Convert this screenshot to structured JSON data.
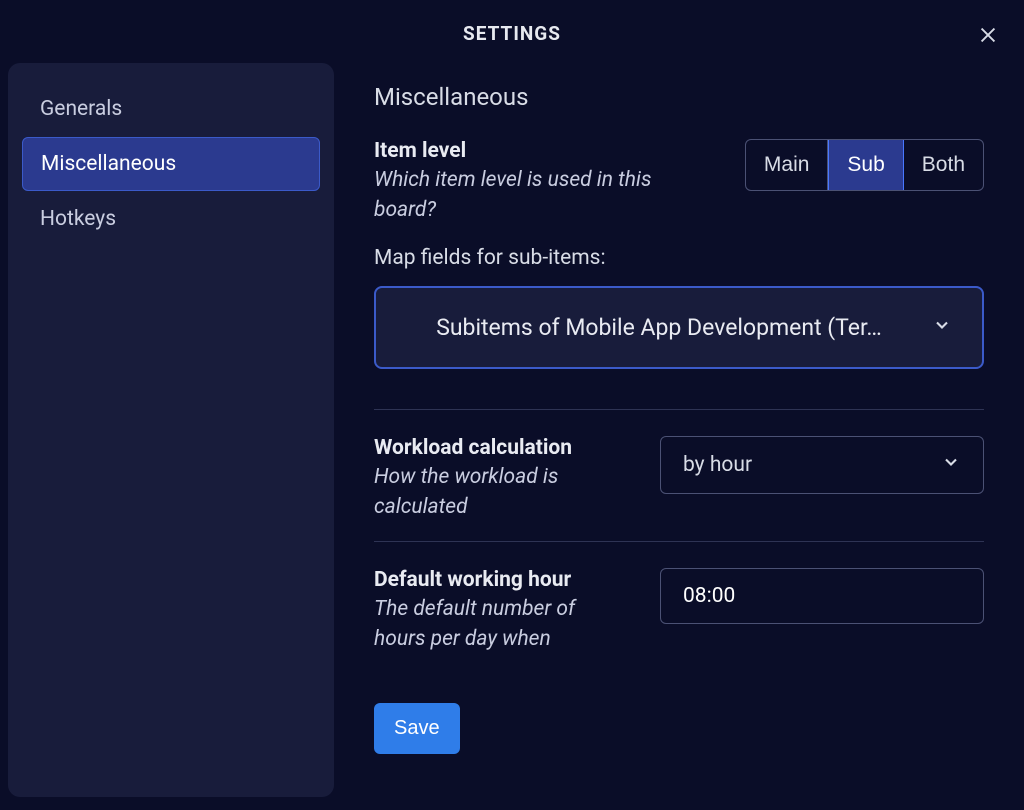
{
  "header": {
    "title": "SETTINGS"
  },
  "sidebar": {
    "items": [
      {
        "label": "Generals",
        "active": false
      },
      {
        "label": "Miscellaneous",
        "active": true
      },
      {
        "label": "Hotkeys",
        "active": false
      }
    ]
  },
  "content": {
    "title": "Miscellaneous",
    "item_level": {
      "label": "Item level",
      "desc": "Which item level is used in this board?",
      "options": [
        "Main",
        "Sub",
        "Both"
      ],
      "selected": "Sub"
    },
    "map_fields": {
      "label": "Map fields for sub-items:",
      "value": "Subitems of Mobile App Development (Ter…"
    },
    "workload": {
      "label": "Workload calculation",
      "desc": "How the workload is calculated",
      "value": "by hour"
    },
    "default_hour": {
      "label": "Default working hour",
      "desc": "The default number of hours per day when",
      "value": "08:00"
    },
    "save_label": "Save"
  }
}
